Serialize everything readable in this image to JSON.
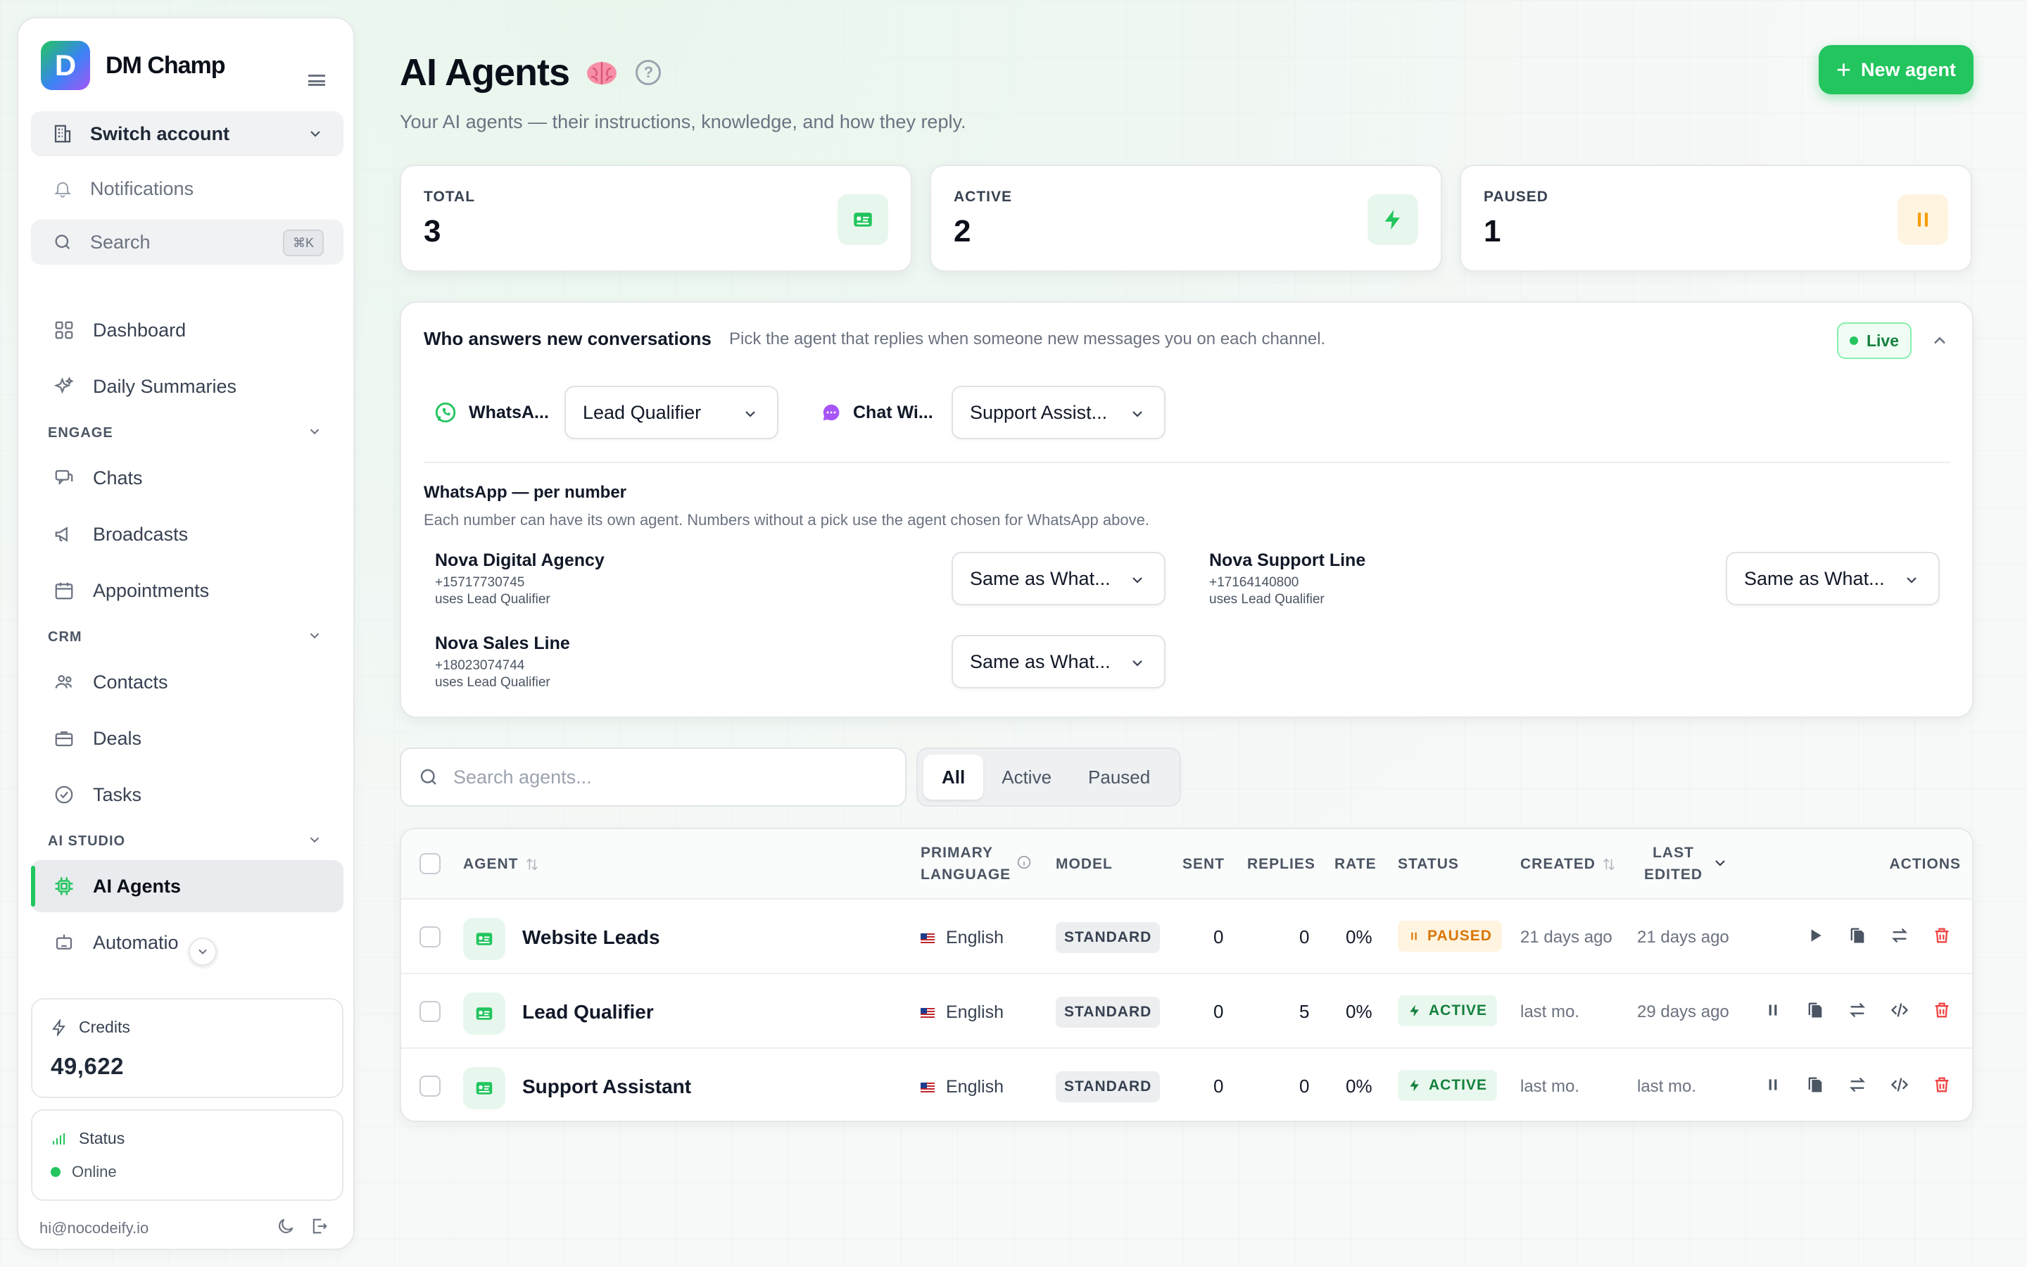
{
  "app": {
    "logo_letter": "D",
    "brand": "DM Champ"
  },
  "sidebar": {
    "switch_account": "Switch account",
    "notifications": "Notifications",
    "search": "Search",
    "search_kbd": "⌘K",
    "items": {
      "dashboard": "Dashboard",
      "daily_summaries": "Daily Summaries",
      "chats": "Chats",
      "broadcasts": "Broadcasts",
      "appointments": "Appointments",
      "contacts": "Contacts",
      "deals": "Deals",
      "tasks": "Tasks",
      "ai_agents": "AI Agents",
      "automations": "Automatio"
    },
    "sections": {
      "engage": "ENGAGE",
      "crm": "CRM",
      "ai_studio": "AI STUDIO"
    },
    "credits_label": "Credits",
    "credits_value": "49,622",
    "status_label": "Status",
    "status_value": "Online",
    "email": "hi@nocodeify.io"
  },
  "header": {
    "title": "AI Agents",
    "subtitle": "Your AI agents — their instructions, knowledge, and how they reply.",
    "new_agent": "New agent",
    "help": "?"
  },
  "stats": [
    {
      "label": "TOTAL",
      "value": "3"
    },
    {
      "label": "ACTIVE",
      "value": "2"
    },
    {
      "label": "PAUSED",
      "value": "1"
    }
  ],
  "routing": {
    "title": "Who answers new conversations",
    "description": "Pick the agent that replies when someone new messages you on each channel.",
    "live": "Live",
    "channels": [
      {
        "name": "WhatsA...",
        "agent": "Lead Qualifier"
      },
      {
        "name": "Chat Wi...",
        "agent": "Support Assist..."
      }
    ],
    "per_number_title": "WhatsApp — per number",
    "per_number_desc": "Each number can have its own agent. Numbers without a pick use the agent chosen for WhatsApp above.",
    "numbers": [
      {
        "name": "Nova Digital Agency",
        "phone": "+15717730745",
        "uses": "uses Lead Qualifier",
        "choice": "Same as What..."
      },
      {
        "name": "Nova Support Line",
        "phone": "+17164140800",
        "uses": "uses Lead Qualifier",
        "choice": "Same as What..."
      },
      {
        "name": "Nova Sales Line",
        "phone": "+18023074744",
        "uses": "uses Lead Qualifier",
        "choice": "Same as What..."
      }
    ]
  },
  "list": {
    "search_placeholder": "Search agents...",
    "filters": [
      "All",
      "Active",
      "Paused"
    ],
    "columns": {
      "agent": "AGENT",
      "primary": "PRIMARY",
      "language": "LANGUAGE",
      "model": "MODEL",
      "sent": "SENT",
      "replies": "REPLIES",
      "rate": "RATE",
      "status": "STATUS",
      "created": "CREATED",
      "last": "LAST",
      "edited": "EDITED",
      "actions": "ACTIONS"
    },
    "rows": [
      {
        "name": "Website Leads",
        "language": "English",
        "model": "STANDARD",
        "sent": "0",
        "replies": "0",
        "rate": "0%",
        "status": "PAUSED",
        "created": "21 days ago",
        "edited": "21 days ago"
      },
      {
        "name": "Lead Qualifier",
        "language": "English",
        "model": "STANDARD",
        "sent": "0",
        "replies": "5",
        "rate": "0%",
        "status": "ACTIVE",
        "created": "last mo.",
        "edited": "29 days ago"
      },
      {
        "name": "Support Assistant",
        "language": "English",
        "model": "STANDARD",
        "sent": "0",
        "replies": "0",
        "rate": "0%",
        "status": "ACTIVE",
        "created": "last mo.",
        "edited": "last mo."
      }
    ]
  },
  "colors": {
    "accent": "#22c55e",
    "paused": "#d97706",
    "danger": "#ef4444"
  }
}
